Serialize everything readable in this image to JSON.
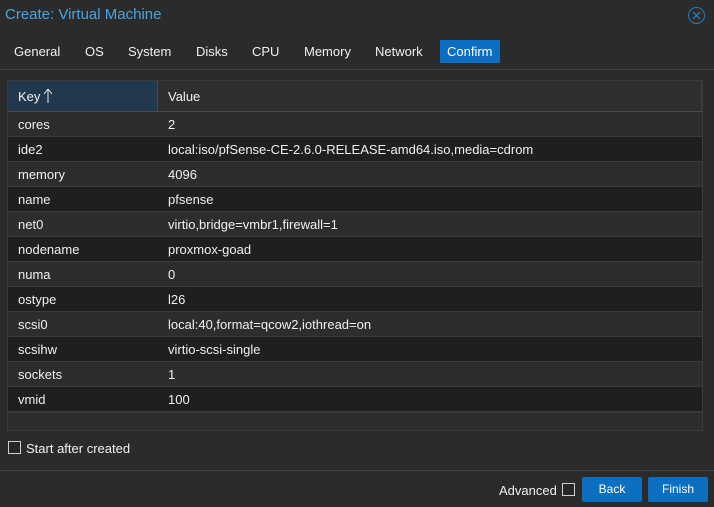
{
  "window": {
    "title": "Create: Virtual Machine",
    "close_icon": "close-circle-icon"
  },
  "tabs": [
    {
      "label": "General"
    },
    {
      "label": "OS"
    },
    {
      "label": "System"
    },
    {
      "label": "Disks"
    },
    {
      "label": "CPU"
    },
    {
      "label": "Memory"
    },
    {
      "label": "Network"
    },
    {
      "label": "Confirm",
      "active": true
    }
  ],
  "grid": {
    "columns": {
      "key": "Key",
      "value": "Value"
    },
    "sort": {
      "column": "key",
      "direction": "ascending"
    },
    "rows": [
      {
        "key": "cores",
        "value": "2"
      },
      {
        "key": "ide2",
        "value": "local:iso/pfSense-CE-2.6.0-RELEASE-amd64.iso,media=cdrom"
      },
      {
        "key": "memory",
        "value": "4096"
      },
      {
        "key": "name",
        "value": "pfsense"
      },
      {
        "key": "net0",
        "value": "virtio,bridge=vmbr1,firewall=1"
      },
      {
        "key": "nodename",
        "value": "proxmox-goad"
      },
      {
        "key": "numa",
        "value": "0"
      },
      {
        "key": "ostype",
        "value": "l26"
      },
      {
        "key": "scsi0",
        "value": "local:40,format=qcow2,iothread=on"
      },
      {
        "key": "scsihw",
        "value": "virtio-scsi-single"
      },
      {
        "key": "sockets",
        "value": "1"
      },
      {
        "key": "vmid",
        "value": "100"
      }
    ]
  },
  "start_after_created": {
    "label": "Start after created",
    "checked": false
  },
  "footer": {
    "advanced_label": "Advanced",
    "advanced_checked": false,
    "back_label": "Back",
    "finish_label": "Finish"
  },
  "colors": {
    "accent": "#0a6fc2",
    "title": "#4aa3df",
    "background": "#2b2b2b"
  }
}
